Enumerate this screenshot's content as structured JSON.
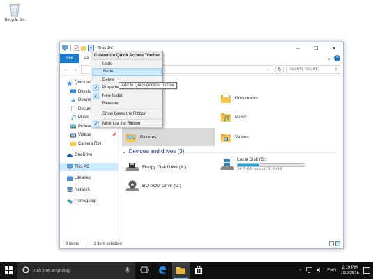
{
  "desktop": {
    "recycle_bin_label": "Recycle Bin"
  },
  "window": {
    "title": "This PC",
    "ribbon_tabs": {
      "file": "File",
      "computer": "Co"
    },
    "search_placeholder": "Search This PC",
    "status": {
      "items": "9 items",
      "selected": "1 item selected"
    }
  },
  "qat_menu": {
    "header": "Customize Quick Access Toolbar",
    "items": [
      {
        "label": "Undo",
        "checked": false
      },
      {
        "label": "Redo",
        "checked": false
      },
      {
        "label": "Delete",
        "checked": false
      },
      {
        "label": "Properties",
        "checked": true
      },
      {
        "label": "New folder",
        "checked": true
      },
      {
        "label": "Rename",
        "checked": false
      },
      {
        "label": "Show below the Ribbon",
        "checked": false
      },
      {
        "label": "Minimize the Ribbon",
        "checked": true
      }
    ],
    "tooltip": "Add to Quick Access Toolbar"
  },
  "nav_pane": {
    "items": [
      {
        "label": "Quick access"
      },
      {
        "label": "Desktop"
      },
      {
        "label": "Downloads"
      },
      {
        "label": "Documents"
      },
      {
        "label": "Music"
      },
      {
        "label": "Pictures"
      },
      {
        "label": "Videos"
      },
      {
        "label": "Camera Roll"
      },
      {
        "label": "OneDrive"
      },
      {
        "label": "This PC"
      },
      {
        "label": "Libraries"
      },
      {
        "label": "Network"
      },
      {
        "label": "Homegroup"
      }
    ]
  },
  "content": {
    "folders": {
      "documents": "Documents",
      "downloads_partial": "ds",
      "music": "Music",
      "pictures": "Pictures",
      "videos": "Videos"
    },
    "devices_header": "Devices and drives (3)",
    "drives": {
      "floppy": "Floppy Disk Drive (A:)",
      "local": "Local Disk (C:)",
      "local_free": "26.7 GB free of 39.2 GB",
      "local_used_fraction": 0.32,
      "bd": "BD-ROM Drive (D:)"
    }
  },
  "taskbar": {
    "search_placeholder": "Ask me anything",
    "lang": "ENG",
    "time": "2:19 PM",
    "date": "7/12/2015"
  },
  "colors": {
    "accent": "#1979ca",
    "selection": "#cce8ff",
    "taskbar": "#101010",
    "folder": "#f4c74d"
  }
}
